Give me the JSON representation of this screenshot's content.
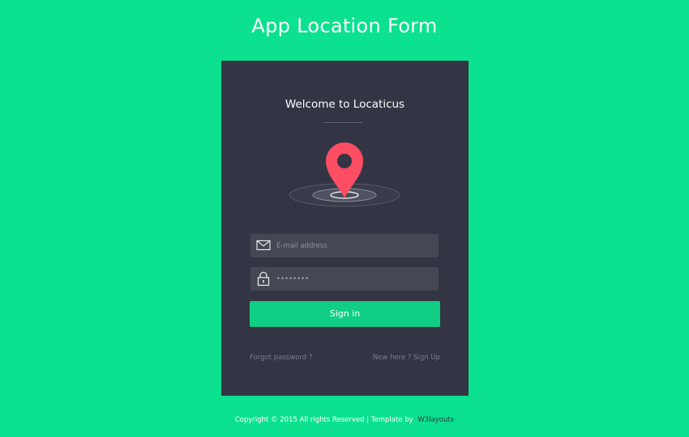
{
  "header": {
    "title": "App Location Form"
  },
  "card": {
    "welcome": "Welcome to Locaticus",
    "pin_icon": "location-pin-icon",
    "email": {
      "placeholder": "E-mail address",
      "value": "",
      "icon": "envelope-icon"
    },
    "password": {
      "value": "••••••••",
      "icon": "padlock-icon"
    },
    "signin_label": "Sign in",
    "forgot_label": "Forgot password ?",
    "signup_label": "New here ? Sign Up"
  },
  "footer": {
    "copyright": "Copyright © 2015 All rights Reserved | Template by",
    "brand": "W3layouts"
  },
  "colors": {
    "background": "#0be18e",
    "card": "#333544",
    "field": "#454753",
    "button": "#10ce84",
    "pin": "#ff4d63"
  }
}
